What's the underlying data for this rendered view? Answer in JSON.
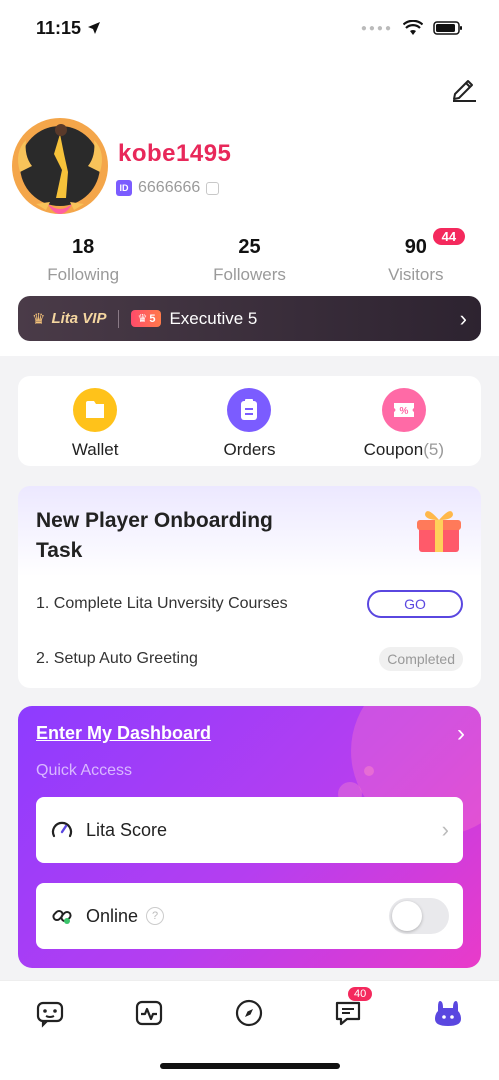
{
  "status_bar": {
    "time": "11:15"
  },
  "profile": {
    "username": "kobe1495",
    "id_badge": "ID",
    "user_id": "6666666"
  },
  "stats": [
    {
      "value": "18",
      "label": "Following"
    },
    {
      "value": "25",
      "label": "Followers"
    },
    {
      "value": "90",
      "label": "Visitors",
      "badge": "44"
    }
  ],
  "vip": {
    "label": "Lita VIP",
    "level_badge": "5",
    "level_text": "Executive 5"
  },
  "quick_actions": [
    {
      "label": "Wallet",
      "icon": "wallet-icon",
      "color": "#ffc21a"
    },
    {
      "label": "Orders",
      "icon": "orders-icon",
      "color": "#7b5cff"
    },
    {
      "label": "Coupon",
      "count": "(5)",
      "icon": "coupon-icon",
      "color": "#ff6aa6"
    }
  ],
  "task": {
    "title": "New Player Onboarding Task",
    "items": [
      {
        "text": "1. Complete Lita Unversity Courses",
        "action": "GO"
      },
      {
        "text": "2. Setup Auto Greeting",
        "action": "Completed"
      }
    ]
  },
  "dashboard": {
    "title": "Enter My Dashboard",
    "subtitle": "Quick Access",
    "rows": [
      {
        "label": "Lita Score",
        "icon": "gauge-icon"
      },
      {
        "label": "Online",
        "icon": "link-icon",
        "help": "?",
        "toggle_on": false
      }
    ]
  },
  "tabbar": {
    "tabs": [
      "game-controller-icon",
      "activity-icon",
      "compass-icon",
      "message-icon",
      "profile-bunny-icon"
    ],
    "message_badge": "40",
    "active_color": "#5a47e0"
  }
}
